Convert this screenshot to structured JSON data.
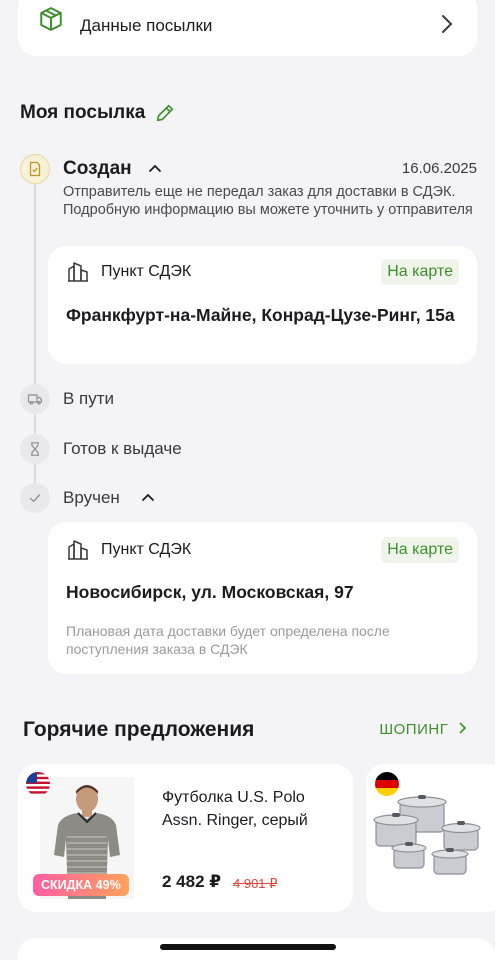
{
  "parcel_data": {
    "label": "Данные посылки"
  },
  "my_parcel": {
    "title": "Моя посылка"
  },
  "steps": [
    {
      "title": "Создан",
      "date": "16.06.2025",
      "description": "Отправитель еще не передал заказ для доставки в СДЭК. Подробную информацию вы можете уточнить у отправителя",
      "point": {
        "label": "Пункт СДЭК",
        "map": "На карте",
        "address": "Франкфурт-на-Майне, Конрад-Цузе-Ринг, 15а"
      }
    },
    {
      "title": "В пути"
    },
    {
      "title": "Готов к выдаче"
    },
    {
      "title": "Вручен",
      "point": {
        "label": "Пункт СДЭК",
        "map": "На карте",
        "address": "Новосибирск, ул. Московская, 97",
        "note": "Плановая дата доставки будет определена после поступления заказа в СДЭК"
      }
    }
  ],
  "offers": {
    "title": "Горячие предложения",
    "shop_link": "ШОПИНГ",
    "products": [
      {
        "name": "Футболка U.S. Polo Assn. Ringer, серый",
        "price": "2 482 ₽",
        "old_price": "4 901 ₽",
        "discount": "СКИДКА 49%",
        "country": "us-flag-icon"
      },
      {
        "country": "de-flag-icon"
      }
    ]
  },
  "colors": {
    "accent": "#3d8f2c",
    "background": "#f4f4f6",
    "discount_start": "#ff5fa2",
    "discount_end": "#ffa15a"
  }
}
